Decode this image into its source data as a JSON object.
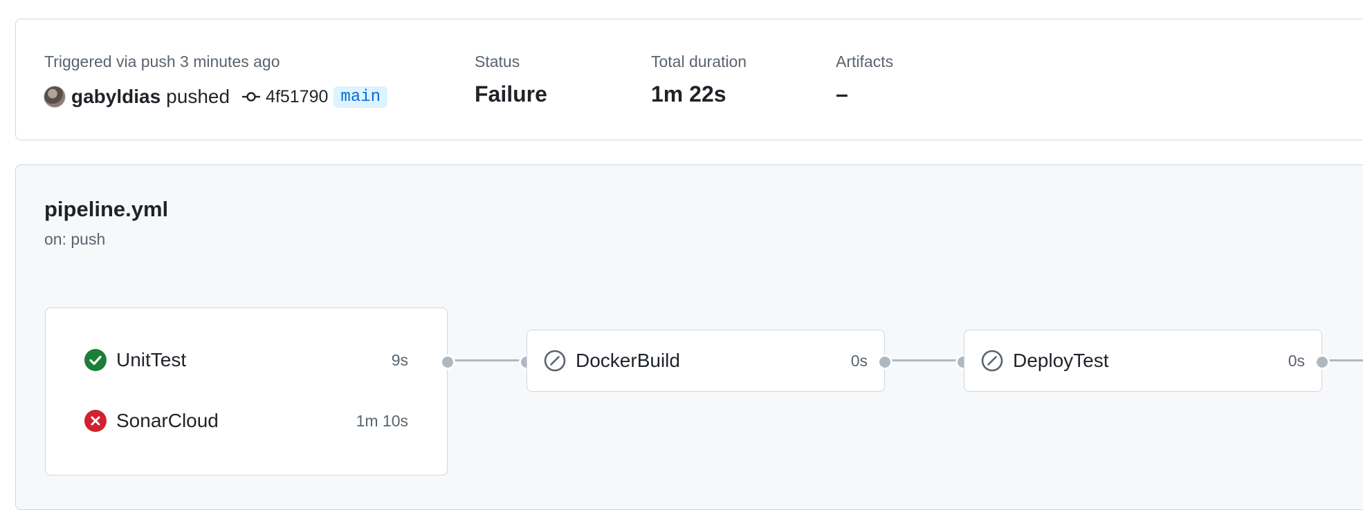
{
  "run_summary": {
    "trigger_text": "Triggered via push 3 minutes ago",
    "actor": "gabyldias",
    "action": "pushed",
    "commit_sha": "4f51790",
    "branch": "main",
    "status_label": "Status",
    "status_value": "Failure",
    "duration_label": "Total duration",
    "duration_value": "1m 22s",
    "artifacts_label": "Artifacts",
    "artifacts_value": "–"
  },
  "workflow": {
    "file": "pipeline.yml",
    "trigger": "on: push",
    "jobs": [
      {
        "name": "UnitTest",
        "duration": "9s",
        "status": "success",
        "icon": "check-circle-icon"
      },
      {
        "name": "SonarCloud",
        "duration": "1m 10s",
        "status": "failure",
        "icon": "x-circle-icon"
      },
      {
        "name": "DockerBuild",
        "duration": "0s",
        "status": "skipped",
        "icon": "skip-icon"
      },
      {
        "name": "DeployTest",
        "duration": "0s",
        "status": "skipped",
        "icon": "skip-icon"
      }
    ]
  },
  "colors": {
    "success": "#1a7f37",
    "failure": "#cf222e",
    "skipped": "#59636e",
    "branch_bg": "#ddf4ff",
    "branch_fg": "#0969da"
  }
}
